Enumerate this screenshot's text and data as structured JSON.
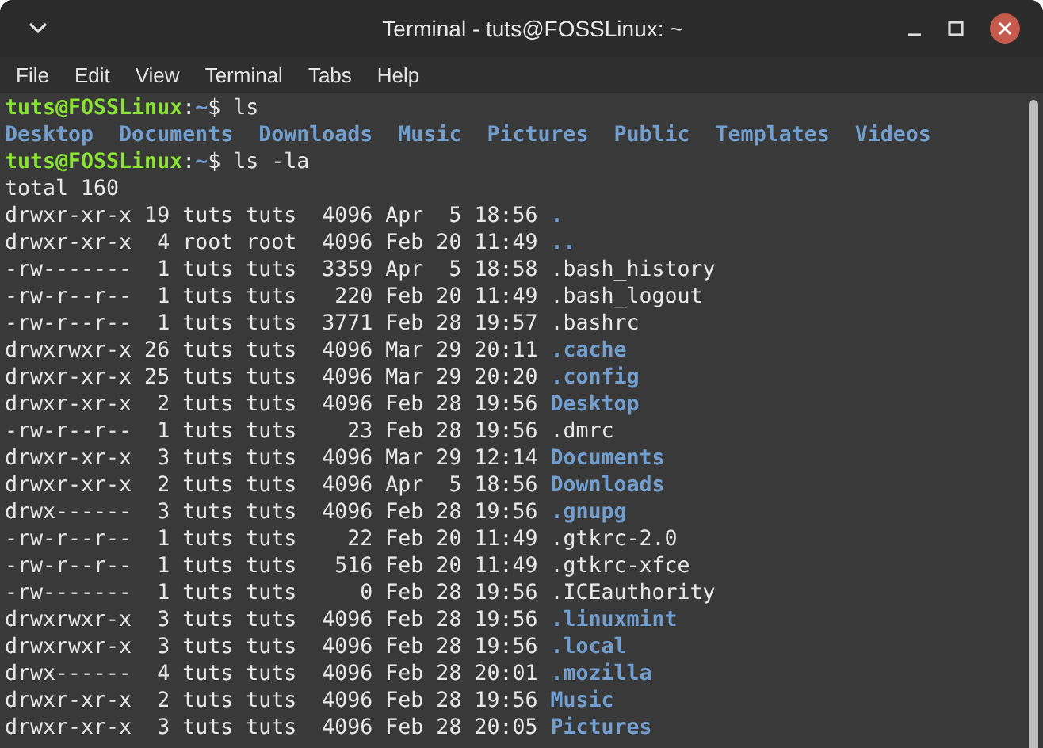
{
  "window": {
    "title": "Terminal - tuts@FOSSLinux: ~"
  },
  "menu": [
    "File",
    "Edit",
    "View",
    "Terminal",
    "Tabs",
    "Help"
  ],
  "lines": [
    {
      "kind": "prompt",
      "user": "tuts@FOSSLinux",
      "separator": ":",
      "path": "~",
      "symbol": "$",
      "command": " ls"
    },
    {
      "kind": "names",
      "items": [
        "Desktop",
        "Documents",
        "Downloads",
        "Music",
        "Pictures",
        "Public",
        "Templates",
        "Videos"
      ]
    },
    {
      "kind": "prompt",
      "user": "tuts@FOSSLinux",
      "separator": ":",
      "path": "~",
      "symbol": "$",
      "command": " ls -la"
    },
    {
      "kind": "text",
      "text": "total 160"
    },
    {
      "kind": "entry",
      "info": "drwxr-xr-x 19 tuts tuts  4096 Apr  5 18:56 ",
      "name": ".",
      "dir": true
    },
    {
      "kind": "entry",
      "info": "drwxr-xr-x  4 root root  4096 Feb 20 11:49 ",
      "name": "..",
      "dir": true
    },
    {
      "kind": "entry",
      "info": "-rw-------  1 tuts tuts  3359 Apr  5 18:58 ",
      "name": ".bash_history",
      "dir": false
    },
    {
      "kind": "entry",
      "info": "-rw-r--r--  1 tuts tuts   220 Feb 20 11:49 ",
      "name": ".bash_logout",
      "dir": false
    },
    {
      "kind": "entry",
      "info": "-rw-r--r--  1 tuts tuts  3771 Feb 28 19:57 ",
      "name": ".bashrc",
      "dir": false
    },
    {
      "kind": "entry",
      "info": "drwxrwxr-x 26 tuts tuts  4096 Mar 29 20:11 ",
      "name": ".cache",
      "dir": true
    },
    {
      "kind": "entry",
      "info": "drwxr-xr-x 25 tuts tuts  4096 Mar 29 20:20 ",
      "name": ".config",
      "dir": true
    },
    {
      "kind": "entry",
      "info": "drwxr-xr-x  2 tuts tuts  4096 Feb 28 19:56 ",
      "name": "Desktop",
      "dir": true
    },
    {
      "kind": "entry",
      "info": "-rw-r--r--  1 tuts tuts    23 Feb 28 19:56 ",
      "name": ".dmrc",
      "dir": false
    },
    {
      "kind": "entry",
      "info": "drwxr-xr-x  3 tuts tuts  4096 Mar 29 12:14 ",
      "name": "Documents",
      "dir": true
    },
    {
      "kind": "entry",
      "info": "drwxr-xr-x  2 tuts tuts  4096 Apr  5 18:56 ",
      "name": "Downloads",
      "dir": true
    },
    {
      "kind": "entry",
      "info": "drwx------  3 tuts tuts  4096 Feb 28 19:56 ",
      "name": ".gnupg",
      "dir": true
    },
    {
      "kind": "entry",
      "info": "-rw-r--r--  1 tuts tuts    22 Feb 20 11:49 ",
      "name": ".gtkrc-2.0",
      "dir": false
    },
    {
      "kind": "entry",
      "info": "-rw-r--r--  1 tuts tuts   516 Feb 20 11:49 ",
      "name": ".gtkrc-xfce",
      "dir": false
    },
    {
      "kind": "entry",
      "info": "-rw-------  1 tuts tuts     0 Feb 28 19:56 ",
      "name": ".ICEauthority",
      "dir": false
    },
    {
      "kind": "entry",
      "info": "drwxrwxr-x  3 tuts tuts  4096 Feb 28 19:56 ",
      "name": ".linuxmint",
      "dir": true
    },
    {
      "kind": "entry",
      "info": "drwxrwxr-x  3 tuts tuts  4096 Feb 28 19:56 ",
      "name": ".local",
      "dir": true
    },
    {
      "kind": "entry",
      "info": "drwx------  4 tuts tuts  4096 Feb 28 20:01 ",
      "name": ".mozilla",
      "dir": true
    },
    {
      "kind": "entry",
      "info": "drwxr-xr-x  2 tuts tuts  4096 Feb 28 19:56 ",
      "name": "Music",
      "dir": true
    },
    {
      "kind": "entry",
      "info": "drwxr-xr-x  3 tuts tuts  4096 Feb 28 20:05 ",
      "name": "Pictures",
      "dir": true
    }
  ]
}
